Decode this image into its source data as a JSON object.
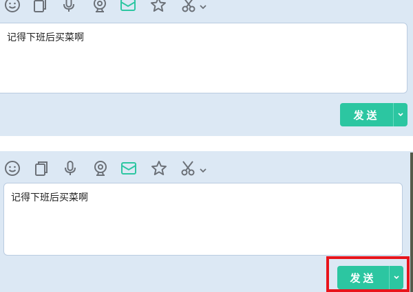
{
  "colors": {
    "panel_bg": "#dce8f4",
    "icon_gray": "#6b7077",
    "icon_active": "#2cc6a1",
    "send_bg": "#2cc6a1",
    "highlight": "#e8141b"
  },
  "toolbar_icons": [
    "emoji-icon",
    "screenshot-copy-icon",
    "microphone-icon",
    "webcam-icon",
    "mail-icon",
    "star-icon",
    "scissors-icon",
    "chevron-down-icon"
  ],
  "top": {
    "message_text": "记得下班后买菜啊",
    "send_label": "发送"
  },
  "bottom": {
    "message_text": "记得下班后买菜啊",
    "send_label": "发送"
  }
}
